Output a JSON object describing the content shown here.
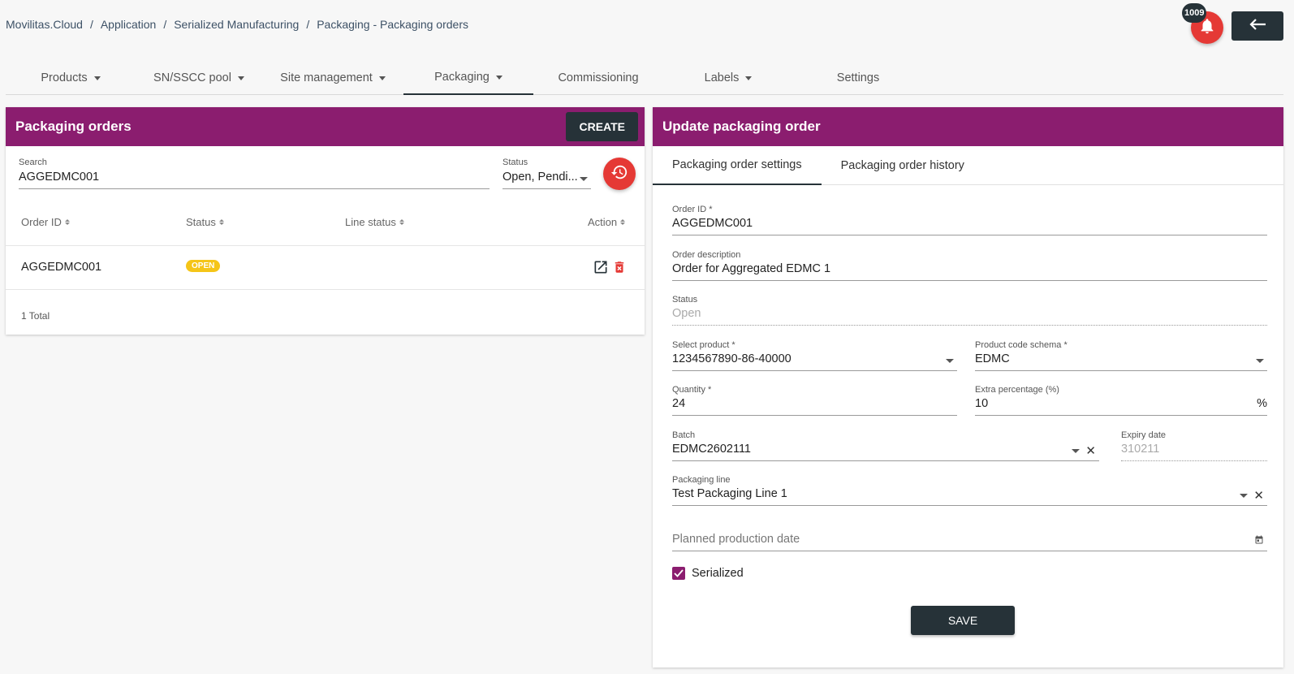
{
  "breadcrumb": [
    "Movilitas.Cloud",
    "Application",
    "Serialized Manufacturing",
    "Packaging - Packaging orders"
  ],
  "notifications": {
    "count": "1009",
    "icon": "bell-icon",
    "color": "#e53935"
  },
  "back_icon": "arrow-left-icon",
  "nav_tabs": [
    {
      "label": "Products",
      "dropdown": true
    },
    {
      "label": "SN/SSCC pool",
      "dropdown": true
    },
    {
      "label": "Site management",
      "dropdown": true
    },
    {
      "label": "Packaging",
      "dropdown": true,
      "active": true
    },
    {
      "label": "Commissioning",
      "dropdown": false
    },
    {
      "label": "Labels",
      "dropdown": true
    },
    {
      "label": "Settings",
      "dropdown": false
    }
  ],
  "left_panel": {
    "title": "Packaging orders",
    "create_label": "CREATE",
    "search": {
      "label": "Search",
      "value": "AGGEDMC001"
    },
    "status": {
      "label": "Status",
      "value": "Open, Pendi..."
    },
    "columns": [
      "Order ID",
      "Status",
      "Line status",
      "Action"
    ],
    "rows": [
      {
        "order_id": "AGGEDMC001",
        "status": "OPEN",
        "line_status": ""
      }
    ],
    "total": "1 Total"
  },
  "right_panel": {
    "title": "Update packaging order",
    "tabs": [
      "Packaging order settings",
      "Packaging order history"
    ],
    "order_id": {
      "label": "Order ID *",
      "value": "AGGEDMC001"
    },
    "description": {
      "label": "Order description",
      "value": "Order for Aggregated EDMC 1"
    },
    "status": {
      "label": "Status",
      "value": "Open"
    },
    "product": {
      "label": "Select product *",
      "value": "1234567890-86-40000"
    },
    "schema": {
      "label": "Product code schema *",
      "value": "EDMC"
    },
    "quantity": {
      "label": "Quantity *",
      "value": "24"
    },
    "extra": {
      "label": "Extra percentage (%)",
      "value": "10",
      "suffix": "%"
    },
    "batch": {
      "label": "Batch",
      "value": "EDMC2602111"
    },
    "expiry": {
      "label": "Expiry date",
      "value": "310211"
    },
    "line": {
      "label": "Packaging line",
      "value": "Test Packaging Line 1"
    },
    "planned_date": {
      "placeholder": "Planned production date"
    },
    "serialized": {
      "label": "Serialized",
      "checked": true
    },
    "save_label": "SAVE"
  },
  "colors": {
    "accent": "#8b1d6f",
    "dark": "#263238",
    "danger": "#e53935",
    "badge_open": "#f5c518"
  }
}
